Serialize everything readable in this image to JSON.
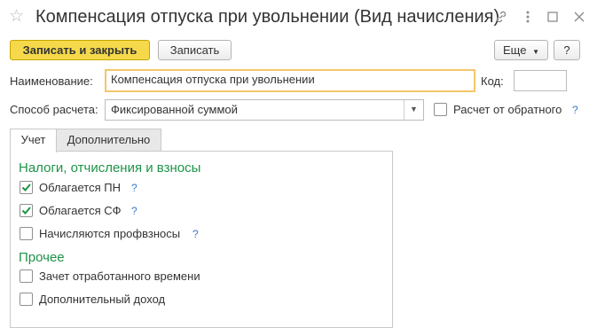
{
  "window": {
    "title": "Компенсация отпуска при увольнении (Вид начисления)"
  },
  "toolbar": {
    "save_close_label": "Записать и закрыть",
    "save_label": "Записать",
    "more_label": "Еще",
    "help_label": "?"
  },
  "form": {
    "name_label": "Наименование:",
    "name_value": "Компенсация отпуска при увольнении",
    "code_label": "Код:",
    "code_value": "",
    "method_label": "Способ расчета:",
    "method_value": "Фиксированной суммой",
    "reverse_calc_label": "Расчет от обратного",
    "reverse_calc_checked": false,
    "reverse_calc_help": "?"
  },
  "tabs": [
    {
      "label": "Учет",
      "active": true
    },
    {
      "label": "Дополнительно",
      "active": false
    }
  ],
  "sections": {
    "taxes_title": "Налоги, отчисления и взносы",
    "other_title": "Прочее"
  },
  "checks": [
    {
      "label": "Облагается ПН",
      "checked": true,
      "help": "?"
    },
    {
      "label": "Облагается СФ",
      "checked": true,
      "help": "?"
    },
    {
      "label": "Начисляются профвзносы",
      "checked": false,
      "help": "?"
    },
    {
      "label": "Зачет отработанного времени",
      "checked": false
    },
    {
      "label": "Дополнительный доход",
      "checked": false
    }
  ],
  "icons": {
    "star": "star-icon",
    "link": "link-icon",
    "menu": "more-vertical-icon",
    "maximize": "maximize-icon",
    "close": "close-icon"
  },
  "colors": {
    "primary_button": "#f5d94a",
    "section_heading": "#1d9448",
    "help_mark": "#3a7bc8",
    "focus_border": "#f3c66b"
  }
}
